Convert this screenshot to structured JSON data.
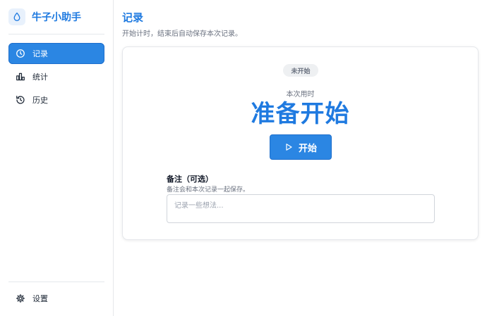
{
  "app": {
    "title": "牛子小助手",
    "logo_icon": "droplet-icon"
  },
  "sidebar": {
    "items": [
      {
        "label": "记录",
        "icon": "clock-icon",
        "active": true
      },
      {
        "label": "统计",
        "icon": "bar-chart-icon",
        "active": false
      },
      {
        "label": "历史",
        "icon": "history-icon",
        "active": false
      }
    ],
    "footer": {
      "label": "设置",
      "icon": "gear-icon"
    }
  },
  "page": {
    "title": "记录",
    "subtitle": "开始计时，结束后自动保存本次记录。"
  },
  "timer": {
    "status_badge": "未开始",
    "elapsed_label": "本次用时",
    "display": "准备开始",
    "start_button": "开始"
  },
  "note": {
    "label": "备注（可选）",
    "help": "备注会和本次记录一起保存。",
    "placeholder": "记录一些想法...",
    "value": ""
  },
  "colors": {
    "accent": "#1f7ae0",
    "accent_button": "#2b86e3"
  }
}
